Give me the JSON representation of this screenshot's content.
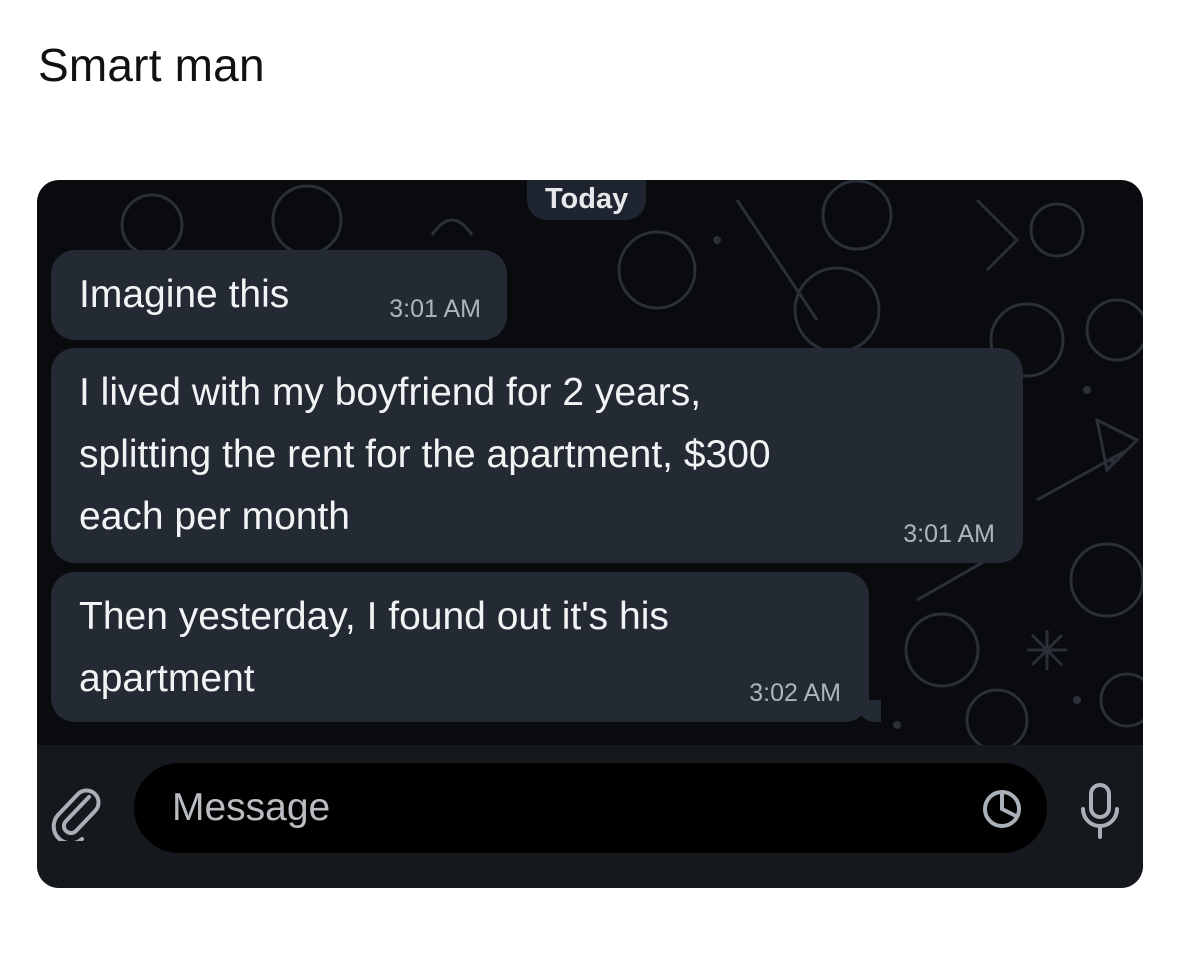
{
  "post": {
    "caption": "Smart man"
  },
  "chat": {
    "date_label": "Today",
    "messages": [
      {
        "text": "Imagine this",
        "time": "3:01 AM"
      },
      {
        "text": "I lived with my boyfriend for 2 years,\nsplitting the rent for the apartment, $300\neach per month",
        "time": "3:01 AM"
      },
      {
        "text": "Then yesterday, I found out it's his\napartment",
        "time": "3:02 AM"
      }
    ],
    "composer": {
      "placeholder": "Message",
      "attach_icon": "paperclip-icon",
      "sticker_icon": "sticker-icon",
      "mic_icon": "microphone-icon"
    },
    "colors": {
      "background": "#090b0e",
      "bubble": "#232a33",
      "composer": "#15181d"
    }
  }
}
